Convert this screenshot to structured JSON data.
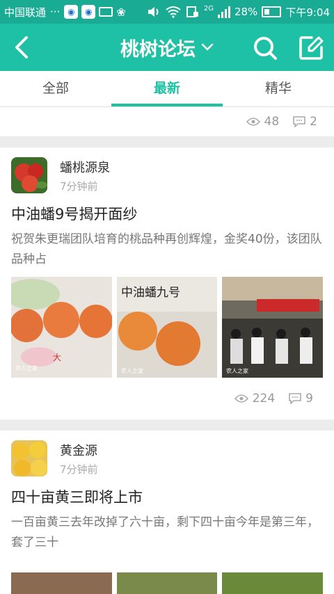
{
  "status_bar": {
    "carrier": "中国联通",
    "dots": "···",
    "network": "2G",
    "battery": "28%",
    "time": "下午9:04"
  },
  "header": {
    "title": "桃树论坛",
    "back_icon": "chevron-left-icon",
    "search_icon": "search-icon",
    "compose_icon": "edit-icon",
    "dropdown_icon": "chevron-down-icon"
  },
  "tabs": [
    {
      "label": "全部"
    },
    {
      "label": "最新"
    },
    {
      "label": "精华"
    }
  ],
  "previous_post": {
    "views": "48",
    "comments": "2"
  },
  "posts": [
    {
      "author": "蟠桃源泉",
      "time": "7分钟前",
      "title": "中油蟠9号揭开面纱",
      "excerpt": "祝贺朱更瑞团队培育的桃品种再创辉煌，金奖40份，该团队品种占",
      "views": "224",
      "comments": "9",
      "image_watermark": "农人之家",
      "image_caption": "中油蟠九号"
    },
    {
      "author": "黄金源",
      "time": "7分钟前",
      "title": "四十亩黄三即将上市",
      "excerpt": "一百亩黄三去年改掉了六十亩，剩下四十亩今年是第三年，套了三十"
    }
  ],
  "colors": {
    "primary": "#1ec1a5",
    "status_bar": "#1aab95"
  }
}
